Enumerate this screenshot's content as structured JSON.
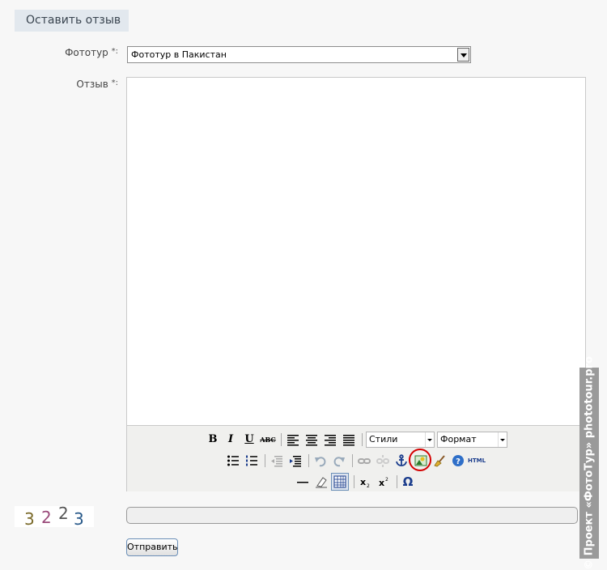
{
  "section": {
    "title": "Оставить отзыв"
  },
  "form": {
    "phototour_label": "Фототур",
    "phototour_value": "Фототур в Пакистан",
    "review_label": "Отзыв",
    "required_mark": "*:"
  },
  "toolbar": {
    "styles_value": "Стили",
    "format_value": "Формат",
    "html_label": "HTML"
  },
  "captcha": {
    "digits": [
      "3",
      "2",
      "2",
      "3"
    ]
  },
  "submit_label": "Отправить",
  "watermark": "© Проект «ФотоТур» phototour.pro",
  "colors": {
    "highlight_circle": "#d40000",
    "button_border": "#6b8fb8"
  }
}
